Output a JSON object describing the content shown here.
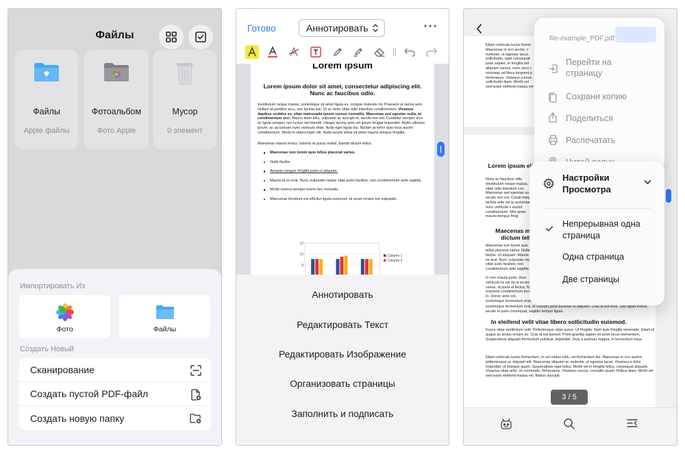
{
  "panel1": {
    "title": "Файлы",
    "locations": [
      {
        "name": "Файлы",
        "sub": "Apple файлы",
        "icon": "folder-blue-icon"
      },
      {
        "name": "Фотоальбом",
        "sub": "Фото Apple",
        "icon": "photos-folder-icon"
      },
      {
        "name": "Мусор",
        "sub": "0 элемент",
        "icon": "trash-can-icon"
      }
    ],
    "import_label": "Импортировать Из",
    "import_items": [
      {
        "label": "Фото",
        "icon": "photos-icon"
      },
      {
        "label": "Файлы",
        "icon": "files-folder-icon"
      }
    ],
    "create_label": "Создать Новый",
    "create_items": [
      {
        "label": "Сканирование",
        "icon": "scan-icon"
      },
      {
        "label": "Создать пустой PDF-файл",
        "icon": "new-file-icon"
      },
      {
        "label": "Создать новую папку",
        "icon": "new-folder-icon"
      }
    ]
  },
  "panel2": {
    "done": "Готово",
    "mode": "Аннотировать",
    "doc_title": "Lorem ipsum",
    "doc_subtitle": "Lorem ipsum dolor sit amet, consectetur adipiscing elit. Nunc ac faucibus odio.",
    "para1_a": "Vestibulum neque massa, scelerisque sit amet ligula eu, congue molestie mi. Praesent ut varius sem. Nullam at porttitor arcu, nec lacinia nisi. Ut ac dolor vitae odio interdum condimentum. ",
    "para1_b": "Vivamus dapibus sodales ex, vitae malesuada ipsum cursus convallis. Maecenas sed egestas nulla, ac condimentum orci.",
    "para1_c": " Mauris diam felis, vulputate ac suscipit et, iaculis non est. Curabitur semper arcu ac ligula semper, nec luctus nisl blandit. Integer lacinia ante vel ipsum feugiat imperdiet. ",
    "para1_d": "Mollis ultricies ipsum, ac accumsan nunc vehicula vitae.",
    "para1_e": " Nulla eget ligula dui. Nullam at tortor quis risus auctor condimentum. Morbi in ullamcorper elit. Nulla iaculis tellus sit amet mauris tempus fringilla.",
    "para2": "Maecenas mauris lectus, lobortis et purus mattis, blandit dictum tellus.",
    "bullets": [
      "Maecenas non lorem quis tellus placerat varius.",
      "Nulla facilisi.",
      "Aenean congue fringilla justo ut aliquam.",
      "Mauris id ex erat. Nunc vulputate neque vitae justo facilisis, non condimentum ante sagittis.",
      "Morbi viverra semper lorem nec molestie.",
      "Maecenas tincidunt est efficitur ligula euismod, sit amet ornare est vulputate."
    ],
    "chart_data": {
      "type": "bar",
      "series": [
        {
          "name": "Column 1",
          "color": "#2c4e9a",
          "values": [
            9.1,
            9.1,
            9.1
          ]
        },
        {
          "name": "Column 2",
          "color": "#e8312d",
          "values": [
            9.1,
            9.5,
            9.1
          ]
        },
        {
          "name": "",
          "color": "#f5b21c",
          "values": [
            9.1,
            9.7,
            9.1
          ]
        }
      ],
      "ylim": [
        6,
        12
      ],
      "yticks": [
        "12",
        "10",
        "8",
        "6"
      ]
    },
    "menu_items": [
      "Аннотировать",
      "Редактировать Текст",
      "Редактировать Изображение",
      "Организовать страницы",
      "Заполнить и подписать"
    ]
  },
  "panel3": {
    "file_name": "file-example_PDF.pdf",
    "menu_items": [
      {
        "label": "Перейти на\nстраницу",
        "icon": "goto-page-icon"
      },
      {
        "label": "Сохрани копию",
        "icon": "copy-icon"
      },
      {
        "label": "Поделиться",
        "icon": "share-icon"
      },
      {
        "label": "Распечатать",
        "icon": "print-icon"
      },
      {
        "label": "Читай вслух",
        "icon": "ear-icon"
      }
    ],
    "view_settings_title": "Настройки\nПросмотра",
    "view_options": [
      "Непрерывная одна\nстраница",
      "Одна страница",
      "Две страницы"
    ],
    "page_indicator": "3 / 5",
    "p1_text": "Etiam vehicula luctus ferme Maecenas in orci auctor, c molestie, ut egestas lacus. sollicitudin, eget consequat justo sapien, in fringilla tell aliquam cursus, nunc arcu c sociosqu ad litora torquent p himenaeos. Vivamus cursus sollicitudin diam. Morbi vel sed turpis eleifend massa vel",
    "p2_title": "Lorem ipsum elit.",
    "p2_text": "Nunc ac faucibus odio. Vestibulum neque massa, vitae odio interdum con Maecenas sed egestas nu et, iaculis non est. Curab integer lacinia ante vel ip accumsan nunc vehicula v auctor condimentum. Mor amet mauris tempus fring",
    "p2_h2": "Maecenas mauris dictum tellus.",
    "p2_text2": "Maecenas non lorem quis tellus placerat varius. Nulla facilisi. Ut aliquam. Mauris id ex erat. Nunc vulputate neque vitae justo facilisis, non condimentum ante sagittis.",
    "p2_text3": "In non mauris justo. Duis vehicula mi vel mi ut ex eros varius, id porta et lectus. Nam euismod condimentum lectus in. Donec ante est, scelerisque fermentum erat, id suscipit justo pulvinar ut. Cras id est eros. Sed ligula metus, iaculis et justo consequat, sagittis tempor ligula.",
    "p2_h3": "In eleifend velit vitae libero sollicitudin euismod.",
    "p2_text4": "Fusce vitae vestibulum velit. Pellentesque vitae purus. Ut fringilla. Nam quis fringilla venenatis. Etiam id augue ac lectus ornare eu. Cras id est laoreet. Proin gravida sapien sit amet lacus elementum, Suspendisse aliquam fermentum pulvinar, imperdiet. Duis a pulvinar magna, in fermentum risus.",
    "p2_text5": "Etiam vehicula luctus fermentum. In vel metus nibh, vel fermentum dui. Maecenas in orci auctor, pellentesque ac aliquam elit. Maecenas aliquam ac molestie, ut egestas lacus. Vivamus a dolor imperdiet, id tristique quam. Suspendisse eget tellus. Morbi vel in fringilla tellus, consequat aliquam. Vivamus vitae ante. Ut commodo, himenaeos. Vivamus cursus, convallis quam, finibus diam. Morbi vel sed turpis eleifend massa vel, finibus suscipit."
  }
}
